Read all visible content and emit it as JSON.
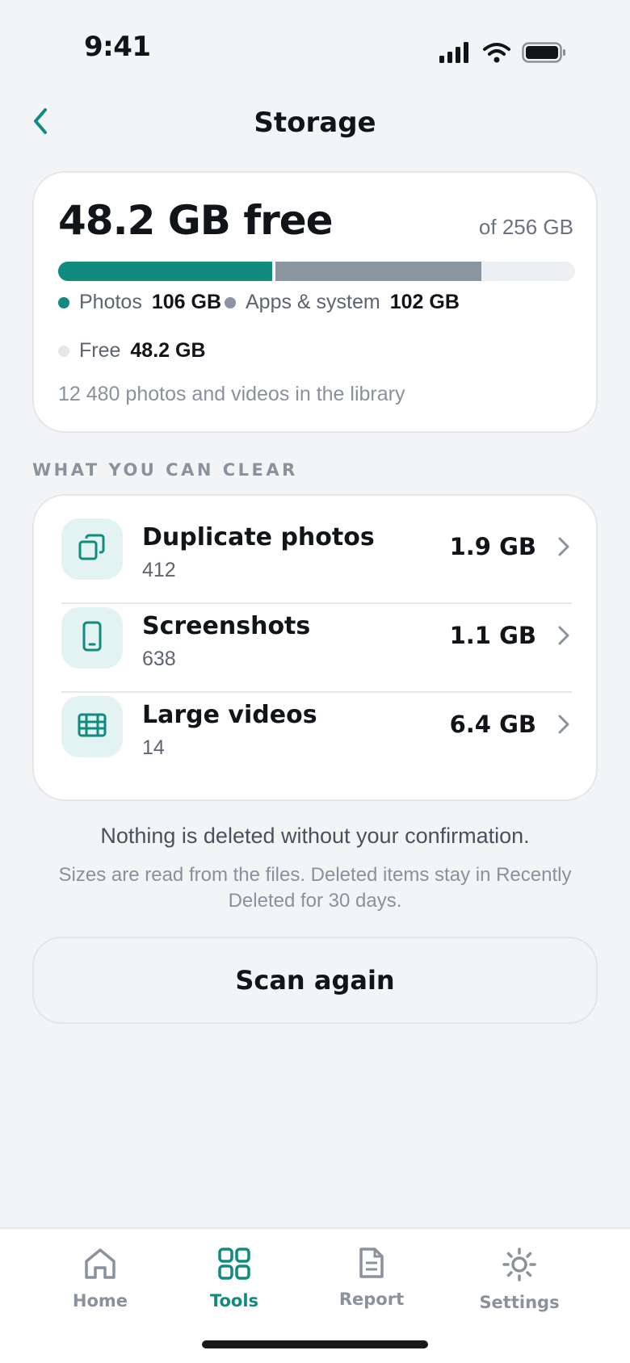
{
  "status_bar": {
    "time": "9:41"
  },
  "header": {
    "title": "Storage",
    "back_icon": "chevron-left-icon"
  },
  "storage": {
    "free_title": "48.2 GB free",
    "total_label": "of 256 GB",
    "usage_fraction": {
      "photos": 0.414,
      "apps": 0.398,
      "free": 0.188
    },
    "legend": [
      {
        "label": "Photos",
        "value": "106 GB",
        "color": "#0f8b80"
      },
      {
        "label": "Apps & system",
        "value": "102 GB",
        "color": "#8b94a1"
      },
      {
        "label": "Free",
        "value": "48.2 GB",
        "color": "#e3e6eb"
      }
    ],
    "library_text": "12 480 photos and videos in the library"
  },
  "section_label": "WHAT YOU CAN CLEAR",
  "clear_items": [
    {
      "title": "Duplicate photos",
      "count": "412",
      "size": "1.9 GB",
      "icon": "copy-icon"
    },
    {
      "title": "Screenshots",
      "count": "638",
      "size": "1.1 GB",
      "icon": "phone-icon"
    },
    {
      "title": "Large videos",
      "count": "14",
      "size": "6.4 GB",
      "icon": "film-icon"
    }
  ],
  "notes": {
    "confirmation": "Nothing is deleted without your confirmation.",
    "detail": "Sizes are read from the files. Deleted items stay in Recently Deleted for 30 days."
  },
  "scan_button": "Scan again",
  "tabs": [
    {
      "label": "Home",
      "icon": "home-icon",
      "active": false
    },
    {
      "label": "Tools",
      "icon": "grid-icon",
      "active": true
    },
    {
      "label": "Report",
      "icon": "document-icon",
      "active": false
    },
    {
      "label": "Settings",
      "icon": "gear-icon",
      "active": false
    }
  ],
  "colors": {
    "accent": "#0f8b80",
    "apps": "#8b94a1",
    "background": "#f3f4f6"
  }
}
